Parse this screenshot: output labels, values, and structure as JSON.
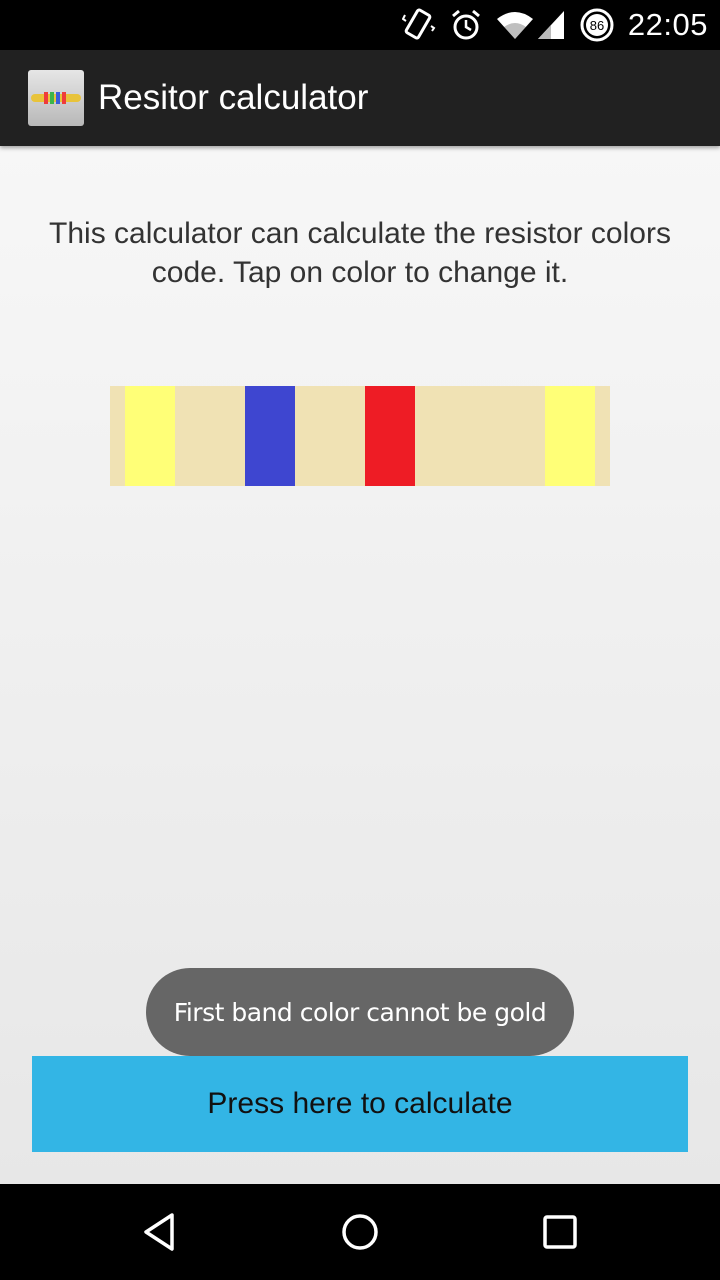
{
  "status_bar": {
    "time": "22:05",
    "battery_level": "86",
    "icons": [
      "vibrate-icon",
      "alarm-icon",
      "wifi-icon",
      "signal-icon",
      "battery-icon"
    ]
  },
  "action_bar": {
    "title": "Resitor calculator",
    "icon": "resistor-app-icon"
  },
  "main": {
    "intro_text": "This calculator can calculate the resistor colors code. Tap on color to change it.",
    "resistor": {
      "body_color": "#f0e2b4",
      "bands": [
        {
          "name": "band-1",
          "color": "#ffff77"
        },
        {
          "name": "band-2",
          "color": "#3e46d0"
        },
        {
          "name": "band-3",
          "color": "#ee1c25"
        },
        {
          "name": "band-4",
          "color": "#ffff77"
        }
      ]
    },
    "toast_text": "First band color cannot be gold",
    "calculate_button_label": "Press here to calculate",
    "calculate_button_color": "#33b5e5"
  },
  "nav_bar": {
    "buttons": [
      "back-icon",
      "home-icon",
      "recents-icon"
    ]
  }
}
